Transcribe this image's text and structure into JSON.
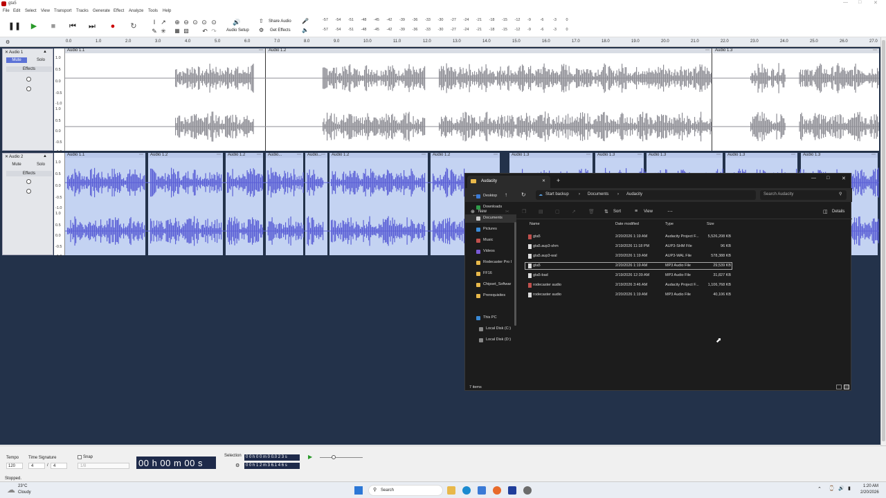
{
  "window": {
    "title": "gta5"
  },
  "menu": [
    "File",
    "Edit",
    "Select",
    "View",
    "Transport",
    "Tracks",
    "Generate",
    "Effect",
    "Analyze",
    "Tools",
    "Help"
  ],
  "toolbar": {
    "audio_setup": "Audio Setup",
    "share_audio": "Share Audio",
    "get_effects": "Get Effects",
    "meter_ticks_top": [
      "-57",
      "-54",
      "-51",
      "-48",
      "-45",
      "-42",
      "-39",
      "-36",
      "-33",
      "-30",
      "-27",
      "-24",
      "-21",
      "-18",
      "-15",
      "-12",
      "-9",
      "-6",
      "-3",
      "0"
    ],
    "meter_ticks_bottom": [
      "-57",
      "-54",
      "-51",
      "-48",
      "-45",
      "-42",
      "-39",
      "-36",
      "-33",
      "-30",
      "-27",
      "-24",
      "-21",
      "-18",
      "-15",
      "-12",
      "-9",
      "-6",
      "-3",
      "0"
    ]
  },
  "ruler": [
    "0.0",
    "1.0",
    "2.0",
    "3.0",
    "4.0",
    "5.0",
    "6.0",
    "7.0",
    "8.0",
    "9.0",
    "10.0",
    "11.0",
    "12.0",
    "13.0",
    "14.0",
    "15.0",
    "16.0",
    "17.0",
    "18.0",
    "19.0",
    "20.0",
    "21.0",
    "22.0",
    "23.0",
    "24.0",
    "25.0",
    "26.0",
    "27.0"
  ],
  "tracks": [
    {
      "name": "Audio 1",
      "mute": "Mute",
      "solo": "Solo",
      "effects": "Effects",
      "scale": [
        "1.0",
        "0.5",
        "0.0",
        "-0.5",
        "-1.0",
        "1.0",
        "0.5",
        "0.0",
        "-0.5",
        "-1.0"
      ],
      "clips": [
        {
          "label": "Audio 1.1"
        },
        {
          "label": "Audio 1.2"
        },
        {
          "label": "Audio 1.3"
        }
      ]
    },
    {
      "name": "Audio 2",
      "mute": "Mute",
      "solo": "Solo",
      "effects": "Effects",
      "scale": [
        "1.0",
        "0.5",
        "0.0",
        "-0.5",
        "-1.0",
        "1.0",
        "0.5",
        "0.0",
        "-0.5",
        "-1.0"
      ],
      "clips": [
        {
          "label": "Audio 1.1"
        },
        {
          "label": "Audio 1.2"
        },
        {
          "label": "Audio 1.2"
        },
        {
          "label": "Audio..."
        },
        {
          "label": "Audio..."
        },
        {
          "label": "Audio 1.2"
        },
        {
          "label": "Audio 1.2"
        },
        {
          "label": "Audio 1.3"
        },
        {
          "label": "Audio 1.3"
        },
        {
          "label": "Audio 1.3"
        },
        {
          "label": "Audio 1.3"
        },
        {
          "label": "Audio 1.3"
        }
      ]
    }
  ],
  "explorer": {
    "tab_title": "Audacity",
    "breadcrumb": [
      "Start backup",
      "Documents",
      "Audacity"
    ],
    "search_placeholder": "Search Audacity",
    "new_label": "New",
    "sort_label": "Sort",
    "view_label": "View",
    "details_label": "Details",
    "columns": [
      "Name",
      "Date modified",
      "Type",
      "Size"
    ],
    "sidebar": [
      "Desktop",
      "Downloads",
      "Documents",
      "Pictures",
      "Music",
      "Videos",
      "Rodecaster Pro I",
      "FF16",
      "Chipset_Softwar",
      "Prerequisites",
      "This PC",
      "Local Disk (C:)",
      "Local Disk (D:)"
    ],
    "files": [
      {
        "name": "gta5",
        "date": "2/20/2026 1:19 AM",
        "type": "Audacity Project F...",
        "size": "5,526,208 KB"
      },
      {
        "name": "gta5.aup3-shm",
        "date": "2/19/2026 11:18 PM",
        "type": "AUP3-SHM File",
        "size": "96 KB"
      },
      {
        "name": "gta5.aup3-wal",
        "date": "2/20/2026 1:19 AM",
        "type": "AUP3-WAL File",
        "size": "578,388 KB"
      },
      {
        "name": "gta5",
        "date": "2/20/2026 1:19 AM",
        "type": "MP3 Audio File",
        "size": "29,539 KB"
      },
      {
        "name": "gta5-bad",
        "date": "2/19/2026 12:39 AM",
        "type": "MP3 Audio File",
        "size": "31,827 KB"
      },
      {
        "name": "rodecaster audio",
        "date": "2/19/2026 3:46 AM",
        "type": "Audacity Project F...",
        "size": "1,106,768 KB"
      },
      {
        "name": "rodecaster audio",
        "date": "2/20/2026 1:19 AM",
        "type": "MP3 Audio File",
        "size": "40,106 KB"
      }
    ],
    "status": "7 items"
  },
  "bottom": {
    "tempo_label": "Tempo",
    "tempo_value": "120",
    "timesig_label": "Time Signature",
    "timesig_num": "4",
    "timesig_den": "4",
    "snap_label": "Snap",
    "snap_value": "1/8",
    "time_display": "00 h 00 m 00 s",
    "selection_label": "Selection",
    "selection_start": "0 0 h 0 0 m 0 0.0 2 3 s",
    "selection_end": "0 0 h 1 2 m 3 6.1 4 6 s",
    "status": "Stopped."
  },
  "taskbar": {
    "weather_temp": "23°C",
    "weather_desc": "Cloudy",
    "search": "Search",
    "time": "1:20 AM",
    "date": "2/20/2026"
  }
}
